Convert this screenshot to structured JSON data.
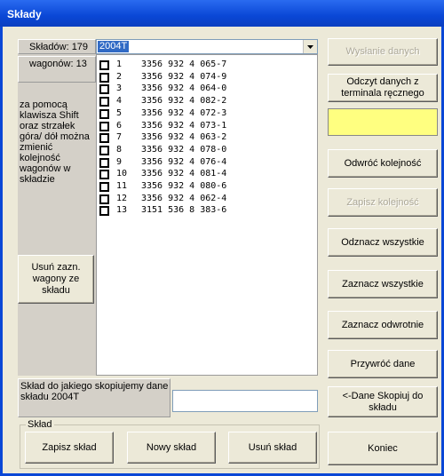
{
  "window": {
    "title": "Składy"
  },
  "counts": {
    "sklady_label": "Składów: 179",
    "wagony_label": "wagonów: 13"
  },
  "combo": {
    "selected": "2004T"
  },
  "help_text": "za pomocą klawisza Shift oraz strzałek góra/ dół można zmienić kolejność wagonów w składzie",
  "remove_selected_label": "Usuń zazn. wagony ze składu",
  "wagons": [
    {
      "num": "1",
      "id": "3356 932 4 065-7"
    },
    {
      "num": "2",
      "id": "3356 932 4 074-9"
    },
    {
      "num": "3",
      "id": "3356 932 4 064-0"
    },
    {
      "num": "4",
      "id": "3356 932 4 082-2"
    },
    {
      "num": "5",
      "id": "3356 932 4 072-3"
    },
    {
      "num": "6",
      "id": "3356 932 4 073-1"
    },
    {
      "num": "7",
      "id": "3356 932 4 063-2"
    },
    {
      "num": "8",
      "id": "3356 932 4 078-0"
    },
    {
      "num": "9",
      "id": "3356 932 4 076-4"
    },
    {
      "num": "10",
      "id": "3356 932 4 081-4"
    },
    {
      "num": "11",
      "id": "3356 932 4 080-6"
    },
    {
      "num": "12",
      "id": "3356 932 4 062-4"
    },
    {
      "num": "13",
      "id": "3151 536 8 383-6"
    }
  ],
  "copy": {
    "label": "Skład do jakiego skopiujemy dane składu 2004T",
    "value": ""
  },
  "group": {
    "title": "Skład",
    "save": "Zapisz skład",
    "new": "Nowy skład",
    "delete": "Usuń skład"
  },
  "right_buttons": {
    "send": "Wysłanie danych",
    "read_terminal": "Odczyt danych z terminala ręcznego",
    "reverse": "Odwróć kolejność",
    "save_order": "Zapisz kolejność",
    "unmark_all": "Odznacz wszystkie",
    "mark_all": "Zaznacz wszystkie",
    "mark_inverse": "Zaznacz odwrotnie",
    "restore": "Przywróć dane",
    "copy_data": "<-Dane Skopiuj do składu",
    "close": "Koniec"
  },
  "colors": {
    "title_bar": "#0a47d6",
    "highlight": "#ffff80",
    "selection": "#316ac5"
  }
}
